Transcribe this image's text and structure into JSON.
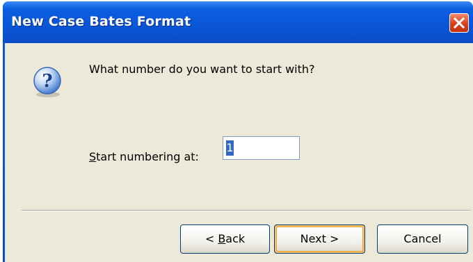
{
  "window": {
    "title": "New Case Bates Format",
    "close_icon": "close-icon"
  },
  "dialog": {
    "icon": "question-icon",
    "prompt": "What number do you want to start with?",
    "field": {
      "label_accel": "S",
      "label_rest": "tart numbering at:",
      "value": "1"
    }
  },
  "buttons": {
    "back_prefix": "< ",
    "back_accel": "B",
    "back_rest": "ack",
    "next_label": "Next >",
    "cancel_label": "Cancel"
  },
  "colors": {
    "titlebar": "#0a56d6",
    "client_bg": "#ece9d8",
    "close_button": "#d8401c",
    "selection": "#316ac5",
    "default_button_focus": "#f5c26a"
  }
}
